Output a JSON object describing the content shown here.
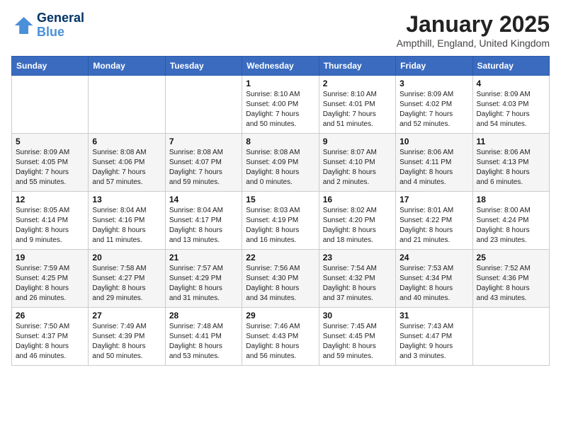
{
  "logo": {
    "line1": "General",
    "line2": "Blue"
  },
  "title": "January 2025",
  "subtitle": "Ampthill, England, United Kingdom",
  "headers": [
    "Sunday",
    "Monday",
    "Tuesday",
    "Wednesday",
    "Thursday",
    "Friday",
    "Saturday"
  ],
  "weeks": [
    [
      {
        "day": "",
        "info": ""
      },
      {
        "day": "",
        "info": ""
      },
      {
        "day": "",
        "info": ""
      },
      {
        "day": "1",
        "info": "Sunrise: 8:10 AM\nSunset: 4:00 PM\nDaylight: 7 hours\nand 50 minutes."
      },
      {
        "day": "2",
        "info": "Sunrise: 8:10 AM\nSunset: 4:01 PM\nDaylight: 7 hours\nand 51 minutes."
      },
      {
        "day": "3",
        "info": "Sunrise: 8:09 AM\nSunset: 4:02 PM\nDaylight: 7 hours\nand 52 minutes."
      },
      {
        "day": "4",
        "info": "Sunrise: 8:09 AM\nSunset: 4:03 PM\nDaylight: 7 hours\nand 54 minutes."
      }
    ],
    [
      {
        "day": "5",
        "info": "Sunrise: 8:09 AM\nSunset: 4:05 PM\nDaylight: 7 hours\nand 55 minutes."
      },
      {
        "day": "6",
        "info": "Sunrise: 8:08 AM\nSunset: 4:06 PM\nDaylight: 7 hours\nand 57 minutes."
      },
      {
        "day": "7",
        "info": "Sunrise: 8:08 AM\nSunset: 4:07 PM\nDaylight: 7 hours\nand 59 minutes."
      },
      {
        "day": "8",
        "info": "Sunrise: 8:08 AM\nSunset: 4:09 PM\nDaylight: 8 hours\nand 0 minutes."
      },
      {
        "day": "9",
        "info": "Sunrise: 8:07 AM\nSunset: 4:10 PM\nDaylight: 8 hours\nand 2 minutes."
      },
      {
        "day": "10",
        "info": "Sunrise: 8:06 AM\nSunset: 4:11 PM\nDaylight: 8 hours\nand 4 minutes."
      },
      {
        "day": "11",
        "info": "Sunrise: 8:06 AM\nSunset: 4:13 PM\nDaylight: 8 hours\nand 6 minutes."
      }
    ],
    [
      {
        "day": "12",
        "info": "Sunrise: 8:05 AM\nSunset: 4:14 PM\nDaylight: 8 hours\nand 9 minutes."
      },
      {
        "day": "13",
        "info": "Sunrise: 8:04 AM\nSunset: 4:16 PM\nDaylight: 8 hours\nand 11 minutes."
      },
      {
        "day": "14",
        "info": "Sunrise: 8:04 AM\nSunset: 4:17 PM\nDaylight: 8 hours\nand 13 minutes."
      },
      {
        "day": "15",
        "info": "Sunrise: 8:03 AM\nSunset: 4:19 PM\nDaylight: 8 hours\nand 16 minutes."
      },
      {
        "day": "16",
        "info": "Sunrise: 8:02 AM\nSunset: 4:20 PM\nDaylight: 8 hours\nand 18 minutes."
      },
      {
        "day": "17",
        "info": "Sunrise: 8:01 AM\nSunset: 4:22 PM\nDaylight: 8 hours\nand 21 minutes."
      },
      {
        "day": "18",
        "info": "Sunrise: 8:00 AM\nSunset: 4:24 PM\nDaylight: 8 hours\nand 23 minutes."
      }
    ],
    [
      {
        "day": "19",
        "info": "Sunrise: 7:59 AM\nSunset: 4:25 PM\nDaylight: 8 hours\nand 26 minutes."
      },
      {
        "day": "20",
        "info": "Sunrise: 7:58 AM\nSunset: 4:27 PM\nDaylight: 8 hours\nand 29 minutes."
      },
      {
        "day": "21",
        "info": "Sunrise: 7:57 AM\nSunset: 4:29 PM\nDaylight: 8 hours\nand 31 minutes."
      },
      {
        "day": "22",
        "info": "Sunrise: 7:56 AM\nSunset: 4:30 PM\nDaylight: 8 hours\nand 34 minutes."
      },
      {
        "day": "23",
        "info": "Sunrise: 7:54 AM\nSunset: 4:32 PM\nDaylight: 8 hours\nand 37 minutes."
      },
      {
        "day": "24",
        "info": "Sunrise: 7:53 AM\nSunset: 4:34 PM\nDaylight: 8 hours\nand 40 minutes."
      },
      {
        "day": "25",
        "info": "Sunrise: 7:52 AM\nSunset: 4:36 PM\nDaylight: 8 hours\nand 43 minutes."
      }
    ],
    [
      {
        "day": "26",
        "info": "Sunrise: 7:50 AM\nSunset: 4:37 PM\nDaylight: 8 hours\nand 46 minutes."
      },
      {
        "day": "27",
        "info": "Sunrise: 7:49 AM\nSunset: 4:39 PM\nDaylight: 8 hours\nand 50 minutes."
      },
      {
        "day": "28",
        "info": "Sunrise: 7:48 AM\nSunset: 4:41 PM\nDaylight: 8 hours\nand 53 minutes."
      },
      {
        "day": "29",
        "info": "Sunrise: 7:46 AM\nSunset: 4:43 PM\nDaylight: 8 hours\nand 56 minutes."
      },
      {
        "day": "30",
        "info": "Sunrise: 7:45 AM\nSunset: 4:45 PM\nDaylight: 8 hours\nand 59 minutes."
      },
      {
        "day": "31",
        "info": "Sunrise: 7:43 AM\nSunset: 4:47 PM\nDaylight: 9 hours\nand 3 minutes."
      },
      {
        "day": "",
        "info": ""
      }
    ]
  ]
}
